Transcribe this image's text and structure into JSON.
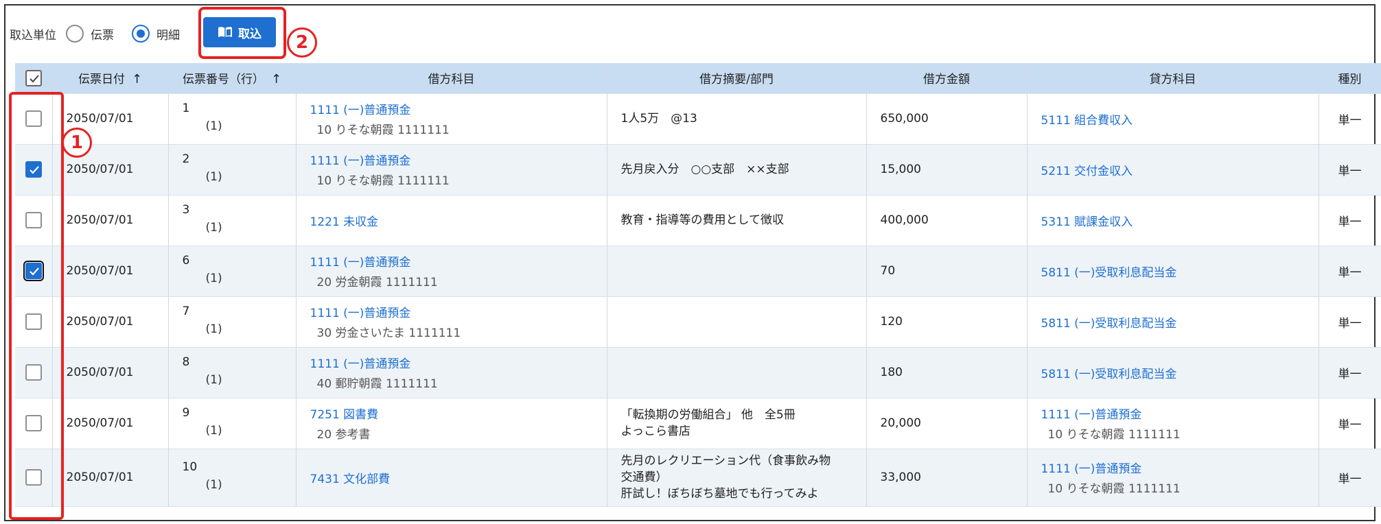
{
  "toolbar": {
    "unit_label": "取込単位",
    "radio_options": [
      {
        "label": "伝票",
        "checked": false
      },
      {
        "label": "明細",
        "checked": true
      }
    ],
    "import_button_label": "取込",
    "import_icon": "book-icon"
  },
  "annotations": {
    "mark1": "1",
    "mark2": "2",
    "highlight_color": "#e52222"
  },
  "colors": {
    "accent": "#1e6fd0",
    "header_bg": "#c9ddf2",
    "alt_row_bg": "#eef3f8"
  },
  "table": {
    "headers": {
      "date": "伝票日付",
      "number": "伝票番号（行）",
      "debit_account": "借方科目",
      "debit_memo": "借方摘要/部門",
      "debit_amount": "借方金額",
      "credit_account": "貸方科目",
      "type": "種別"
    },
    "sort_arrow": "↑",
    "rows": [
      {
        "checked": false,
        "date": "2050/07/01",
        "no": "1",
        "line": "(1)",
        "debit": "1111 (一)普通預金",
        "debit_sub": "10 りそな朝霞 1111111",
        "memo": [
          "1人5万　@13"
        ],
        "amount": "650,000",
        "credit": "5111 組合費収入",
        "credit_sub": "",
        "type": "単一"
      },
      {
        "checked": true,
        "date": "2050/07/01",
        "no": "2",
        "line": "(1)",
        "debit": "1111 (一)普通預金",
        "debit_sub": "10 りそな朝霞 1111111",
        "memo": [
          "先月戻入分　○○支部　××支部"
        ],
        "amount": "15,000",
        "credit": "5211 交付金収入",
        "credit_sub": "",
        "type": "単一"
      },
      {
        "checked": false,
        "date": "2050/07/01",
        "no": "3",
        "line": "(1)",
        "debit": "1221 未収金",
        "debit_sub": "",
        "memo": [
          "教育・指導等の費用として徴収"
        ],
        "amount": "400,000",
        "credit": "5311 賦課金収入",
        "credit_sub": "",
        "type": "単一"
      },
      {
        "checked": true,
        "focus": true,
        "date": "2050/07/01",
        "no": "6",
        "line": "(1)",
        "debit": "1111 (一)普通預金",
        "debit_sub": "20 労金朝霞 1111111",
        "memo": [],
        "amount": "70",
        "credit": "5811 (一)受取利息配当金",
        "credit_sub": "",
        "type": "単一"
      },
      {
        "checked": false,
        "date": "2050/07/01",
        "no": "7",
        "line": "(1)",
        "debit": "1111 (一)普通預金",
        "debit_sub": "30 労金さいたま 1111111",
        "memo": [],
        "amount": "120",
        "credit": "5811 (一)受取利息配当金",
        "credit_sub": "",
        "type": "単一"
      },
      {
        "checked": false,
        "date": "2050/07/01",
        "no": "8",
        "line": "(1)",
        "debit": "1111 (一)普通預金",
        "debit_sub": "40 郵貯朝霞 1111111",
        "memo": [],
        "amount": "180",
        "credit": "5811 (一)受取利息配当金",
        "credit_sub": "",
        "type": "単一"
      },
      {
        "checked": false,
        "date": "2050/07/01",
        "no": "9",
        "line": "(1)",
        "debit": "7251 図書費",
        "debit_sub": "20 参考書",
        "memo": [
          "「転換期の労働組合」 他　全5冊",
          "よっこら書店"
        ],
        "amount": "20,000",
        "credit": "1111 (一)普通預金",
        "credit_sub": "10 りそな朝霞 1111111",
        "type": "単一"
      },
      {
        "checked": false,
        "date": "2050/07/01",
        "no": "10",
        "line": "(1)",
        "debit": "7431 文化部費",
        "debit_sub": "",
        "memo": [
          "先月のレクリエーション代（食事飲み物",
          "交通費）",
          "肝試し！ぼちぼち墓地でも行ってみよ"
        ],
        "amount": "33,000",
        "credit": "1111 (一)普通預金",
        "credit_sub": "10 りそな朝霞 1111111",
        "type": "単一"
      }
    ]
  }
}
